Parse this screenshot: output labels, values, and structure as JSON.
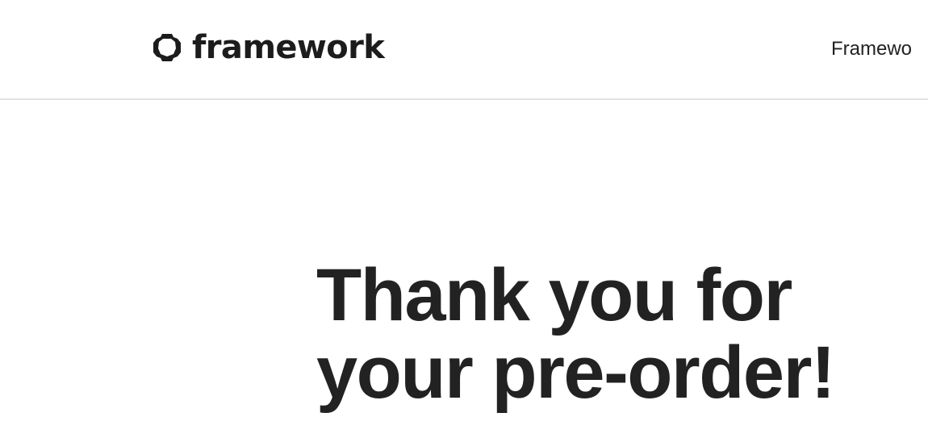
{
  "header": {
    "logo": {
      "icon": "framework-gear-icon",
      "text": "framework"
    },
    "nav": {
      "link_label": "Framewo"
    }
  },
  "main": {
    "title_line_1": "Thank you for",
    "title_line_2": "your pre-order!"
  },
  "colors": {
    "text": "#222222",
    "divider": "#e2e2e2",
    "background": "#ffffff"
  }
}
